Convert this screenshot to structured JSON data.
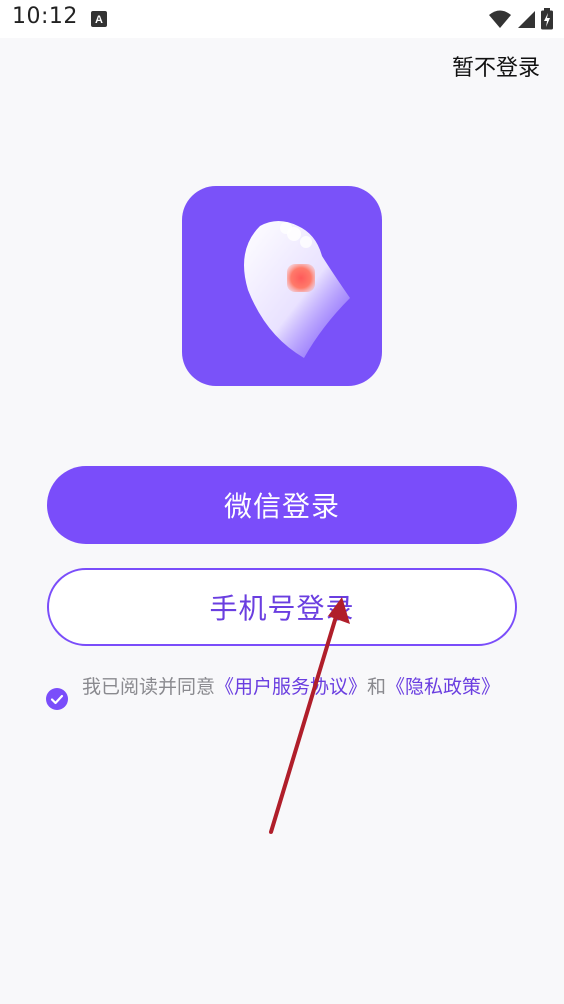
{
  "status_bar": {
    "time": "10:12",
    "icons": [
      "accessibility-a-icon",
      "wifi-icon",
      "signal-icon",
      "battery-icon"
    ]
  },
  "header": {
    "skip_label": "暂不登录"
  },
  "logo": {
    "icon": "app-logo-icon",
    "background": "#7a52f9"
  },
  "buttons": {
    "wechat_label": "微信登录",
    "phone_label": "手机号登录"
  },
  "agreement": {
    "prefix": "我已阅读并同意",
    "user_agreement": "《用户服务协议》",
    "conjunction": "和",
    "privacy_policy": "《隐私政策》",
    "checked": true
  },
  "colors": {
    "accent": "#7a4dfa",
    "accent_text": "#6a3ee0",
    "background": "#f8f8fa",
    "annotation_arrow": "#b01e2a"
  }
}
